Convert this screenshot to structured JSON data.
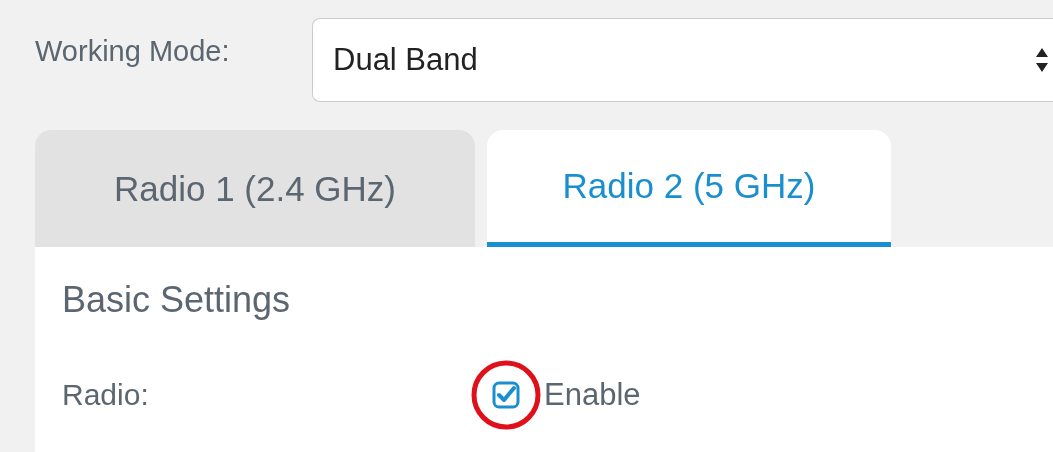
{
  "working_mode": {
    "label": "Working Mode:",
    "value": "Dual Band"
  },
  "tabs": [
    {
      "label": "Radio 1 (2.4 GHz)",
      "selected": false
    },
    {
      "label": "Radio 2 (5 GHz)",
      "selected": true
    }
  ],
  "section_title": "Basic Settings",
  "radio": {
    "label": "Radio:",
    "checked": true,
    "option": "Enable",
    "highlighted": true
  }
}
